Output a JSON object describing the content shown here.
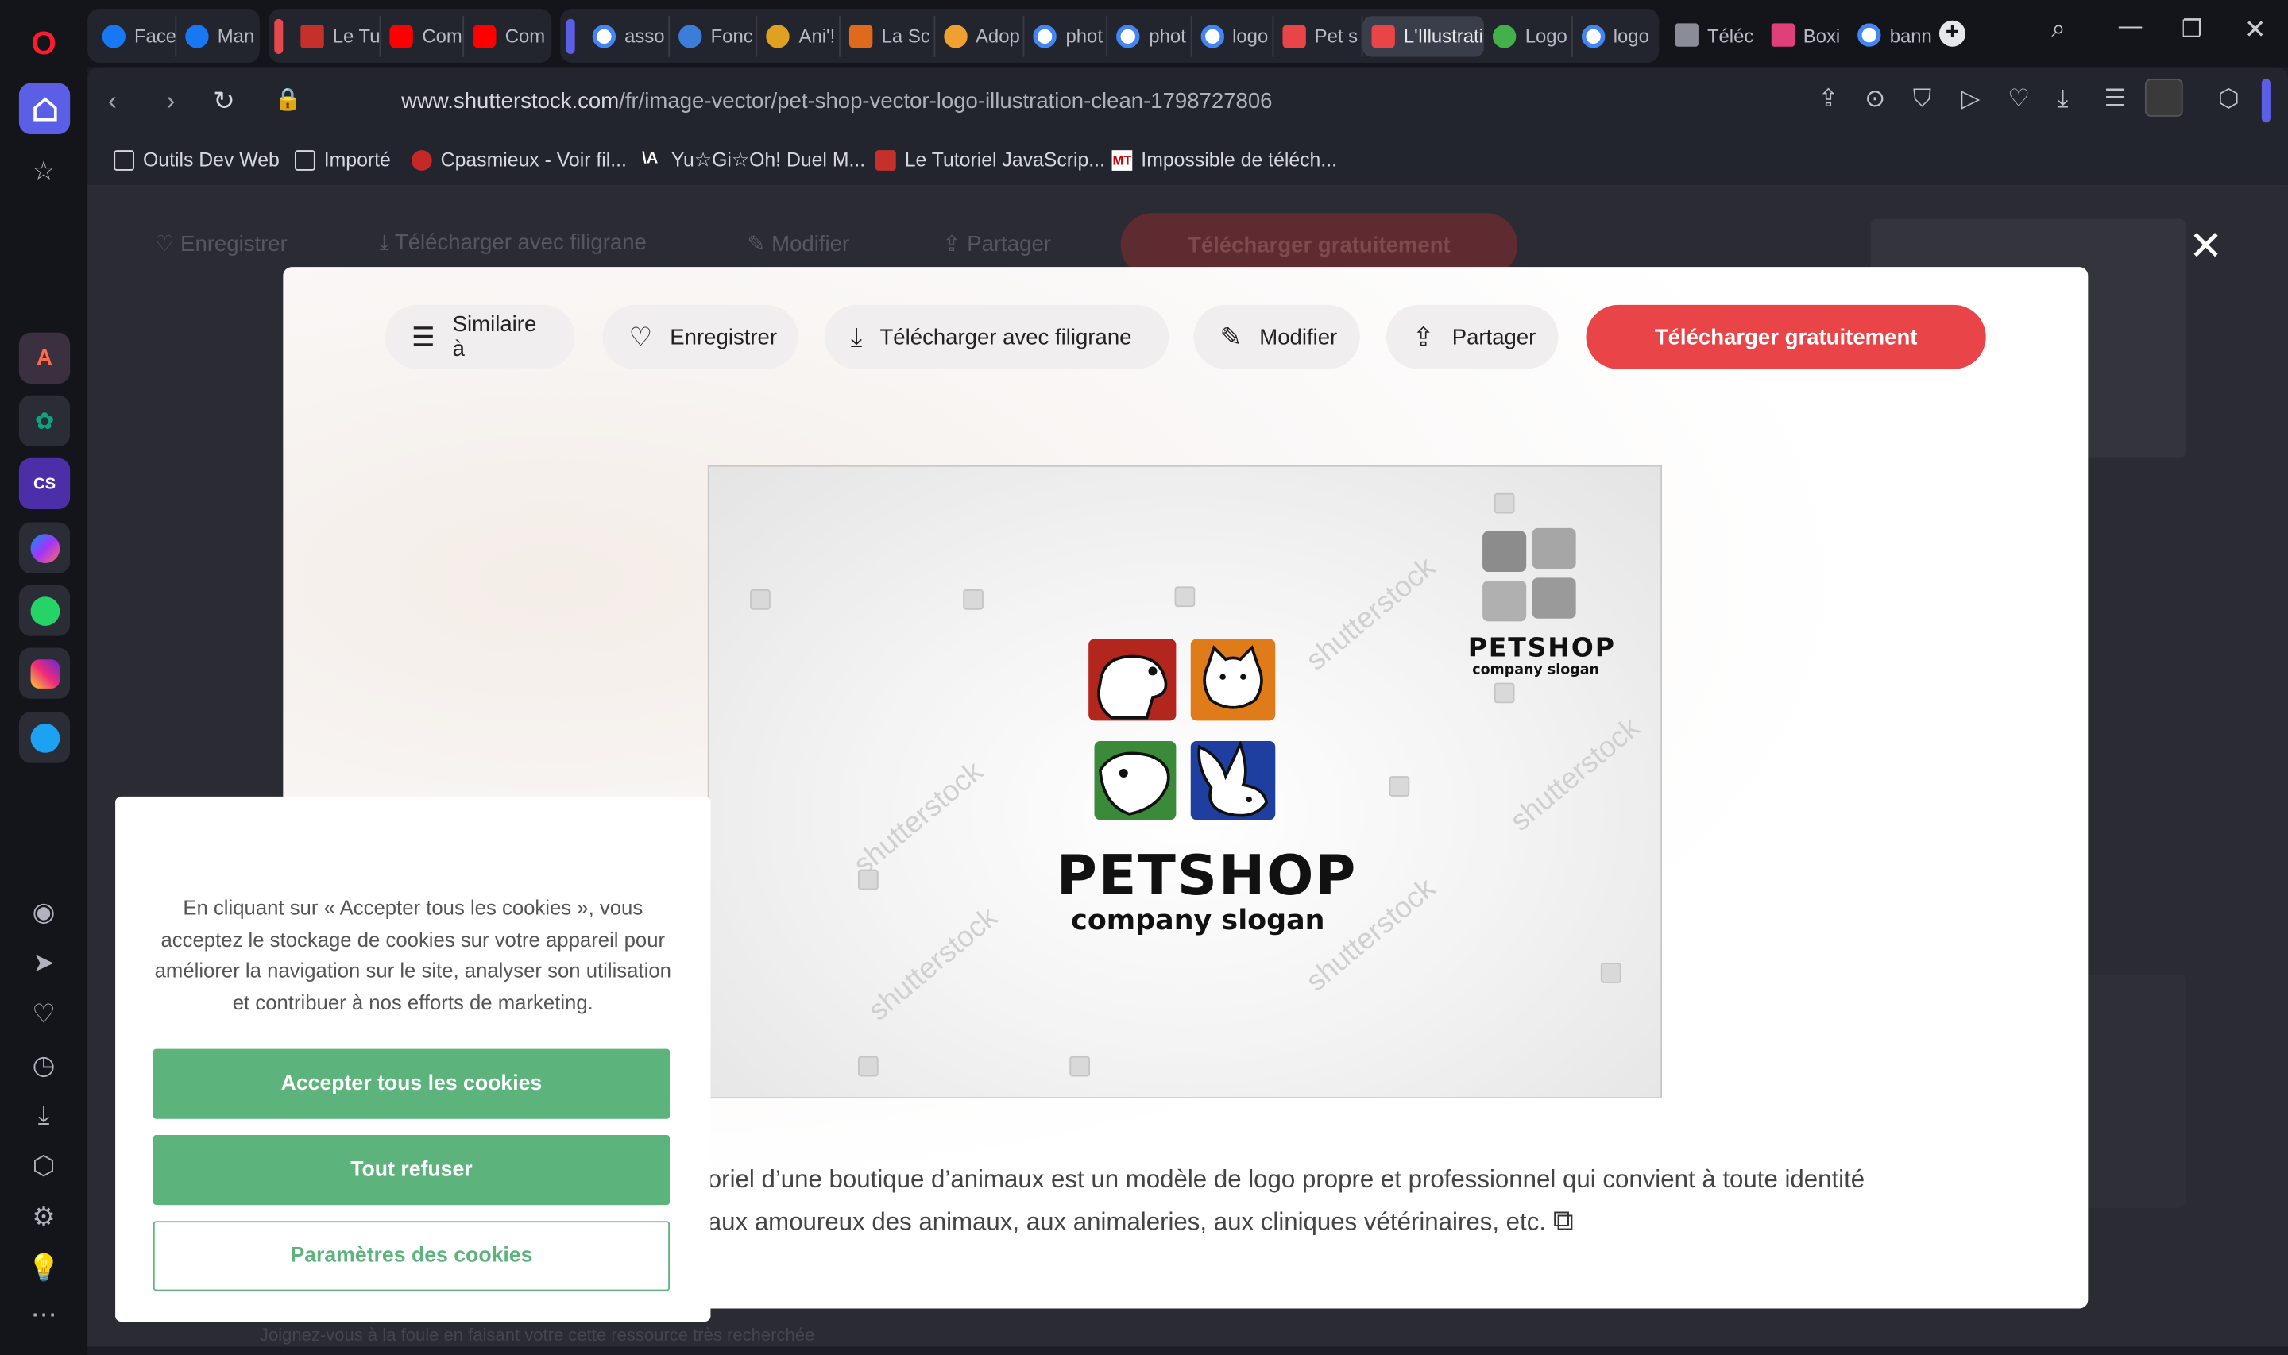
{
  "browser": {
    "tabs_group1": [
      "Face",
      "Man"
    ],
    "tabs_group2": [
      "Le Tu",
      "Com",
      "Com"
    ],
    "tabs_group3": [
      "asso",
      "Fonc",
      "Ani'!",
      "La Sc",
      "Adop",
      "phot",
      "phot",
      "logo",
      "Pet s",
      "L'Illustrati",
      "Logo",
      "logo"
    ],
    "tabs_after": [
      "Téléc",
      "Boxi",
      "bann"
    ],
    "url_domain": "www.shutterstock.com",
    "url_path": "/fr/image-vector/pet-shop-vector-logo-illustration-clean-1798727806",
    "bookmarks": [
      "Outils Dev Web",
      "Importé",
      "Cpasmieux - Voir fil...",
      "Yu☆Gi☆Oh! Duel M...",
      "Le Tutoriel JavaScrip...",
      "Impossible de téléch..."
    ]
  },
  "background_bar": {
    "save": "Enregistrer",
    "download_wm": "Télécharger avec filigrane",
    "edit": "Modifier",
    "share": "Partager",
    "download_free": "Télécharger gratuitement"
  },
  "modal": {
    "similar": "Similaire à",
    "save": "Enregistrer",
    "download_wm": "Télécharger avec filigrane",
    "edit": "Modifier",
    "share": "Partager",
    "download_free": "Télécharger gratuitement",
    "logo_title": "PETSHOP",
    "logo_slogan": "company slogan",
    "small_logo_title": "PETSHOP",
    "small_logo_slogan": "company slogan",
    "watermark": "shutterstock",
    "description_line1": "oriel d’une boutique d’animaux est un modèle de logo propre et professionnel qui convient à toute identité",
    "description_line2": "aux amoureux des animaux, aux animaleries, aux cliniques vétérinaires, etc."
  },
  "cookie": {
    "text": "En cliquant sur « Accepter tous les cookies », vous acceptez le stockage de cookies sur votre appareil pour améliorer la navigation sur le site, analyser son utilisation et contribuer à nos efforts de marketing.",
    "accept": "Accepter tous les cookies",
    "reject": "Tout refuser",
    "settings": "Paramètres des cookies"
  },
  "page_hint": "Joignez-vous à la foule en faisant votre cette ressource très recherchée",
  "colors": {
    "accent_red": "#e94448",
    "cookie_green": "#5cb37b",
    "opera_blue": "#5b5fe6",
    "tile_red": "#b3261e",
    "tile_orange": "#e07b1a",
    "tile_green": "#3a8a3a",
    "tile_blue": "#1f3fa0"
  }
}
